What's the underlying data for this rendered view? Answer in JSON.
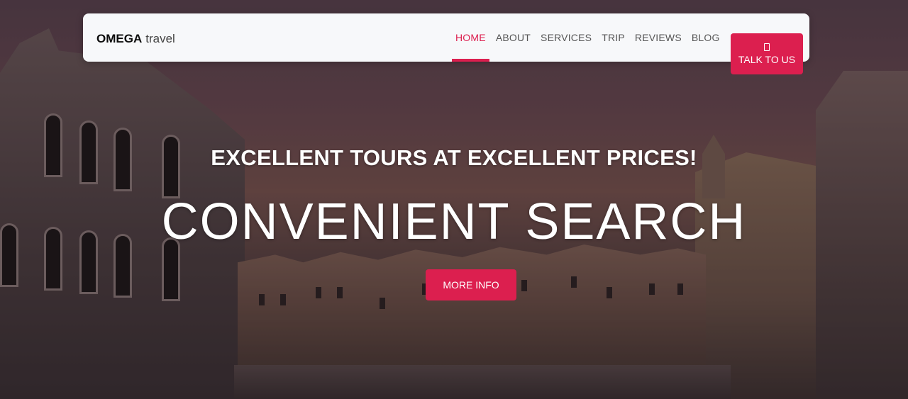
{
  "brand": {
    "strong": "OMEGA",
    "light": "travel"
  },
  "nav": {
    "items": [
      {
        "label": "HOME",
        "active": true
      },
      {
        "label": "ABOUT",
        "active": false
      },
      {
        "label": "SERVICES",
        "active": false
      },
      {
        "label": "TRIP",
        "active": false
      },
      {
        "label": "REVIEWS",
        "active": false
      },
      {
        "label": "BLOG",
        "active": false
      }
    ],
    "cta": {
      "icon": "phone-icon",
      "label": "TALK TO US"
    }
  },
  "hero": {
    "tagline": "EXCELLENT TOURS AT EXCELLENT PRICES!",
    "headline": "CONVENIENT SEARCH",
    "button_label": "MORE INFO"
  },
  "colors": {
    "accent": "#dc1f4f",
    "nav_bg": "#f7f8fa"
  }
}
